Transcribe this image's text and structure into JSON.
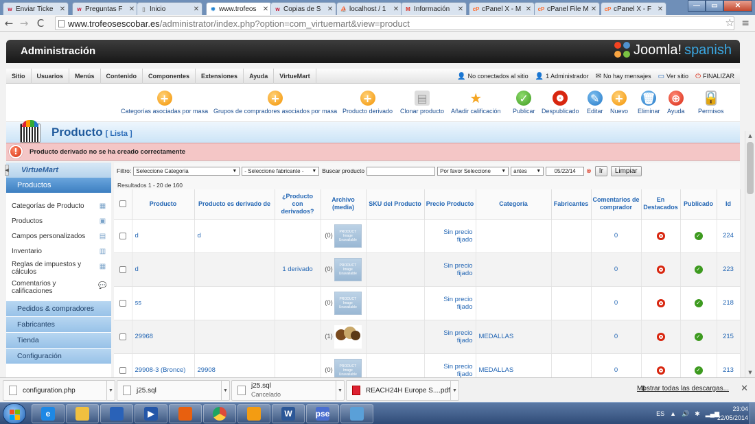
{
  "browser": {
    "tabs": [
      {
        "label": "Enviar Ticke",
        "icon": "w",
        "icon_color": "#c8102e",
        "active": false
      },
      {
        "label": "Preguntas F",
        "icon": "w",
        "icon_color": "#c8102e",
        "active": false
      },
      {
        "label": "Inicio",
        "icon": "page",
        "icon_color": "#888888",
        "active": false
      },
      {
        "label": "www.trofeos",
        "icon": "joomla",
        "icon_color": "#1c7fcf",
        "active": true
      },
      {
        "label": "Copias de S",
        "icon": "w",
        "icon_color": "#c8102e",
        "active": false
      },
      {
        "label": "localhost / 1",
        "icon": "pma",
        "icon_color": "#f29111",
        "active": false
      },
      {
        "label": "Información",
        "icon": "M",
        "icon_color": "#d93025",
        "active": false
      },
      {
        "label": "cPanel X - M",
        "icon": "cP",
        "icon_color": "#ff6c2c",
        "active": false
      },
      {
        "label": "cPanel File M",
        "icon": "cP",
        "icon_color": "#ff6c2c",
        "active": false
      },
      {
        "label": "cPanel X - F",
        "icon": "cP",
        "icon_color": "#ff6c2c",
        "active": false
      }
    ],
    "url_host": "www.trofeosescobar.es",
    "url_path": "/administrator/index.php?option=com_virtuemart&view=product"
  },
  "admin": {
    "title": "Administración",
    "logo_word": "Joomla!",
    "logo_lang": "spanish",
    "menu": [
      "Sitio",
      "Usuarios",
      "Menús",
      "Contenido",
      "Componentes",
      "Extensiones",
      "Ayuda",
      "VirtueMart"
    ],
    "status": {
      "visitors": "No conectados al sitio",
      "admins": "1 Administrador",
      "messages": "No hay mensajes",
      "view_site": "Ver sitio",
      "logout": "FINALIZAR"
    },
    "toolbar": [
      {
        "label": "Categorías asociadas por masa",
        "icon": "plus",
        "color": "or"
      },
      {
        "label": "Grupos de compradores asociados por masa",
        "icon": "plus",
        "color": "or"
      },
      {
        "label": "Producto derivado",
        "icon": "plus",
        "color": "or"
      },
      {
        "label": "Clonar producto",
        "icon": "copy",
        "color": "gy"
      },
      {
        "label": "Añadir calificación",
        "icon": "star",
        "color": "st"
      },
      {
        "label": "Publicar",
        "icon": "check",
        "color": "gr"
      },
      {
        "label": "Despublicado",
        "icon": "circle",
        "color": "rd"
      },
      {
        "label": "Editar",
        "icon": "pencil",
        "color": "bl"
      },
      {
        "label": "Nuevo",
        "icon": "plus",
        "color": "or"
      },
      {
        "label": "Eliminar",
        "icon": "trash",
        "color": "bl"
      },
      {
        "label": "Ayuda",
        "icon": "lifebuoy",
        "color": "rd"
      },
      {
        "label": "Permisos",
        "icon": "lock",
        "color": "lk"
      }
    ],
    "page_title": "Producto",
    "page_subtitle": "[ Lista ]",
    "alert": "Producto derivado no se ha creado correctamente"
  },
  "sidebar": {
    "logo": "VirtueMart",
    "head": "Productos",
    "items": [
      {
        "label": "Categorías de Producto",
        "icon": "folder-icon"
      },
      {
        "label": "Productos",
        "icon": "box-icon"
      },
      {
        "label": "Campos personalizados",
        "icon": "custom-fields-icon"
      },
      {
        "label": "Inventario",
        "icon": "inventory-icon"
      },
      {
        "label": "Reglas de impuestos y cálculos",
        "icon": "calculator-icon"
      },
      {
        "label": "Comentarios y calificaciones",
        "icon": "comments-icon"
      }
    ],
    "sections": [
      "Pedidos & compradores",
      "Fabricantes",
      "Tienda",
      "Configuración"
    ]
  },
  "filters": {
    "label_filter": "Filtro:",
    "category": "Seleccione Categoría",
    "manufacturer": "- Seleccione fabricante -",
    "search_label": "Buscar producto",
    "search_value": "",
    "date_mode": "Por favor Seleccione",
    "date_rel": "antes",
    "date": "05/22/14",
    "go": "Ir",
    "reset": "Limpiar",
    "results": "Resultados 1 - 20 de 160"
  },
  "table": {
    "headers": [
      "Producto",
      "Producto es derivado de",
      "¿Producto con derivados?",
      "Archivo (media)",
      "SKU del Producto",
      "Precio Producto",
      "Categoría",
      "Fabricantes",
      "Comentarios de comprador",
      "En Destacados",
      "Publicado",
      "Id"
    ],
    "media_placeholder": "PRODUCT Image Unavailable",
    "rows": [
      {
        "name": "d",
        "parent": "d",
        "children": "",
        "media_count": "(0)",
        "media": "placeholder",
        "sku": "",
        "price": "Sin precio fijado",
        "category": "",
        "manufacturer": "",
        "reviews": "0",
        "featured": "no",
        "published": "yes",
        "id": "224"
      },
      {
        "name": "d",
        "parent": "",
        "children": "1 derivado",
        "media_count": "(0)",
        "media": "placeholder",
        "sku": "",
        "price": "Sin precio fijado",
        "category": "",
        "manufacturer": "",
        "reviews": "0",
        "featured": "no",
        "published": "yes",
        "id": "223"
      },
      {
        "name": "ss",
        "parent": "",
        "children": "",
        "media_count": "(0)",
        "media": "placeholder",
        "sku": "",
        "price": "Sin precio fijado",
        "category": "",
        "manufacturer": "",
        "reviews": "0",
        "featured": "no",
        "published": "yes",
        "id": "218"
      },
      {
        "name": "29968",
        "parent": "",
        "children": "",
        "media_count": "(1)",
        "media": "image",
        "sku": "",
        "price": "Sin precio fijado",
        "category": "MEDALLAS",
        "manufacturer": "",
        "reviews": "0",
        "featured": "no",
        "published": "yes",
        "id": "215"
      },
      {
        "name": "29908-3 (Bronce)",
        "parent": "29908",
        "children": "",
        "media_count": "(0)",
        "media": "placeholder",
        "sku": "",
        "price": "Sin precio fijado",
        "category": "MEDALLAS",
        "manufacturer": "",
        "reviews": "0",
        "featured": "no",
        "published": "yes",
        "id": "213"
      }
    ]
  },
  "downloads": {
    "items": [
      {
        "name": "configuration.php",
        "sub": "",
        "icon": "file"
      },
      {
        "name": "j25.sql",
        "sub": "",
        "icon": "file"
      },
      {
        "name": "j25.sql",
        "sub": "Cancelado",
        "icon": "file"
      },
      {
        "name": "REACH24H Europe S....pdf",
        "sub": "",
        "icon": "pdf"
      }
    ],
    "show_all": "Mostrar todas las descargas..."
  },
  "taskbar": {
    "apps": [
      "internet-explorer",
      "explorer",
      "app",
      "media-player",
      "xampp",
      "chrome",
      "vlc-app",
      "word",
      "pse",
      "notes"
    ],
    "app_labels": [
      "e",
      "",
      "",
      "▶",
      "",
      "",
      "",
      "W",
      "pse",
      ""
    ],
    "lang": "ES",
    "time": "23:04",
    "date": "22/05/2014"
  }
}
